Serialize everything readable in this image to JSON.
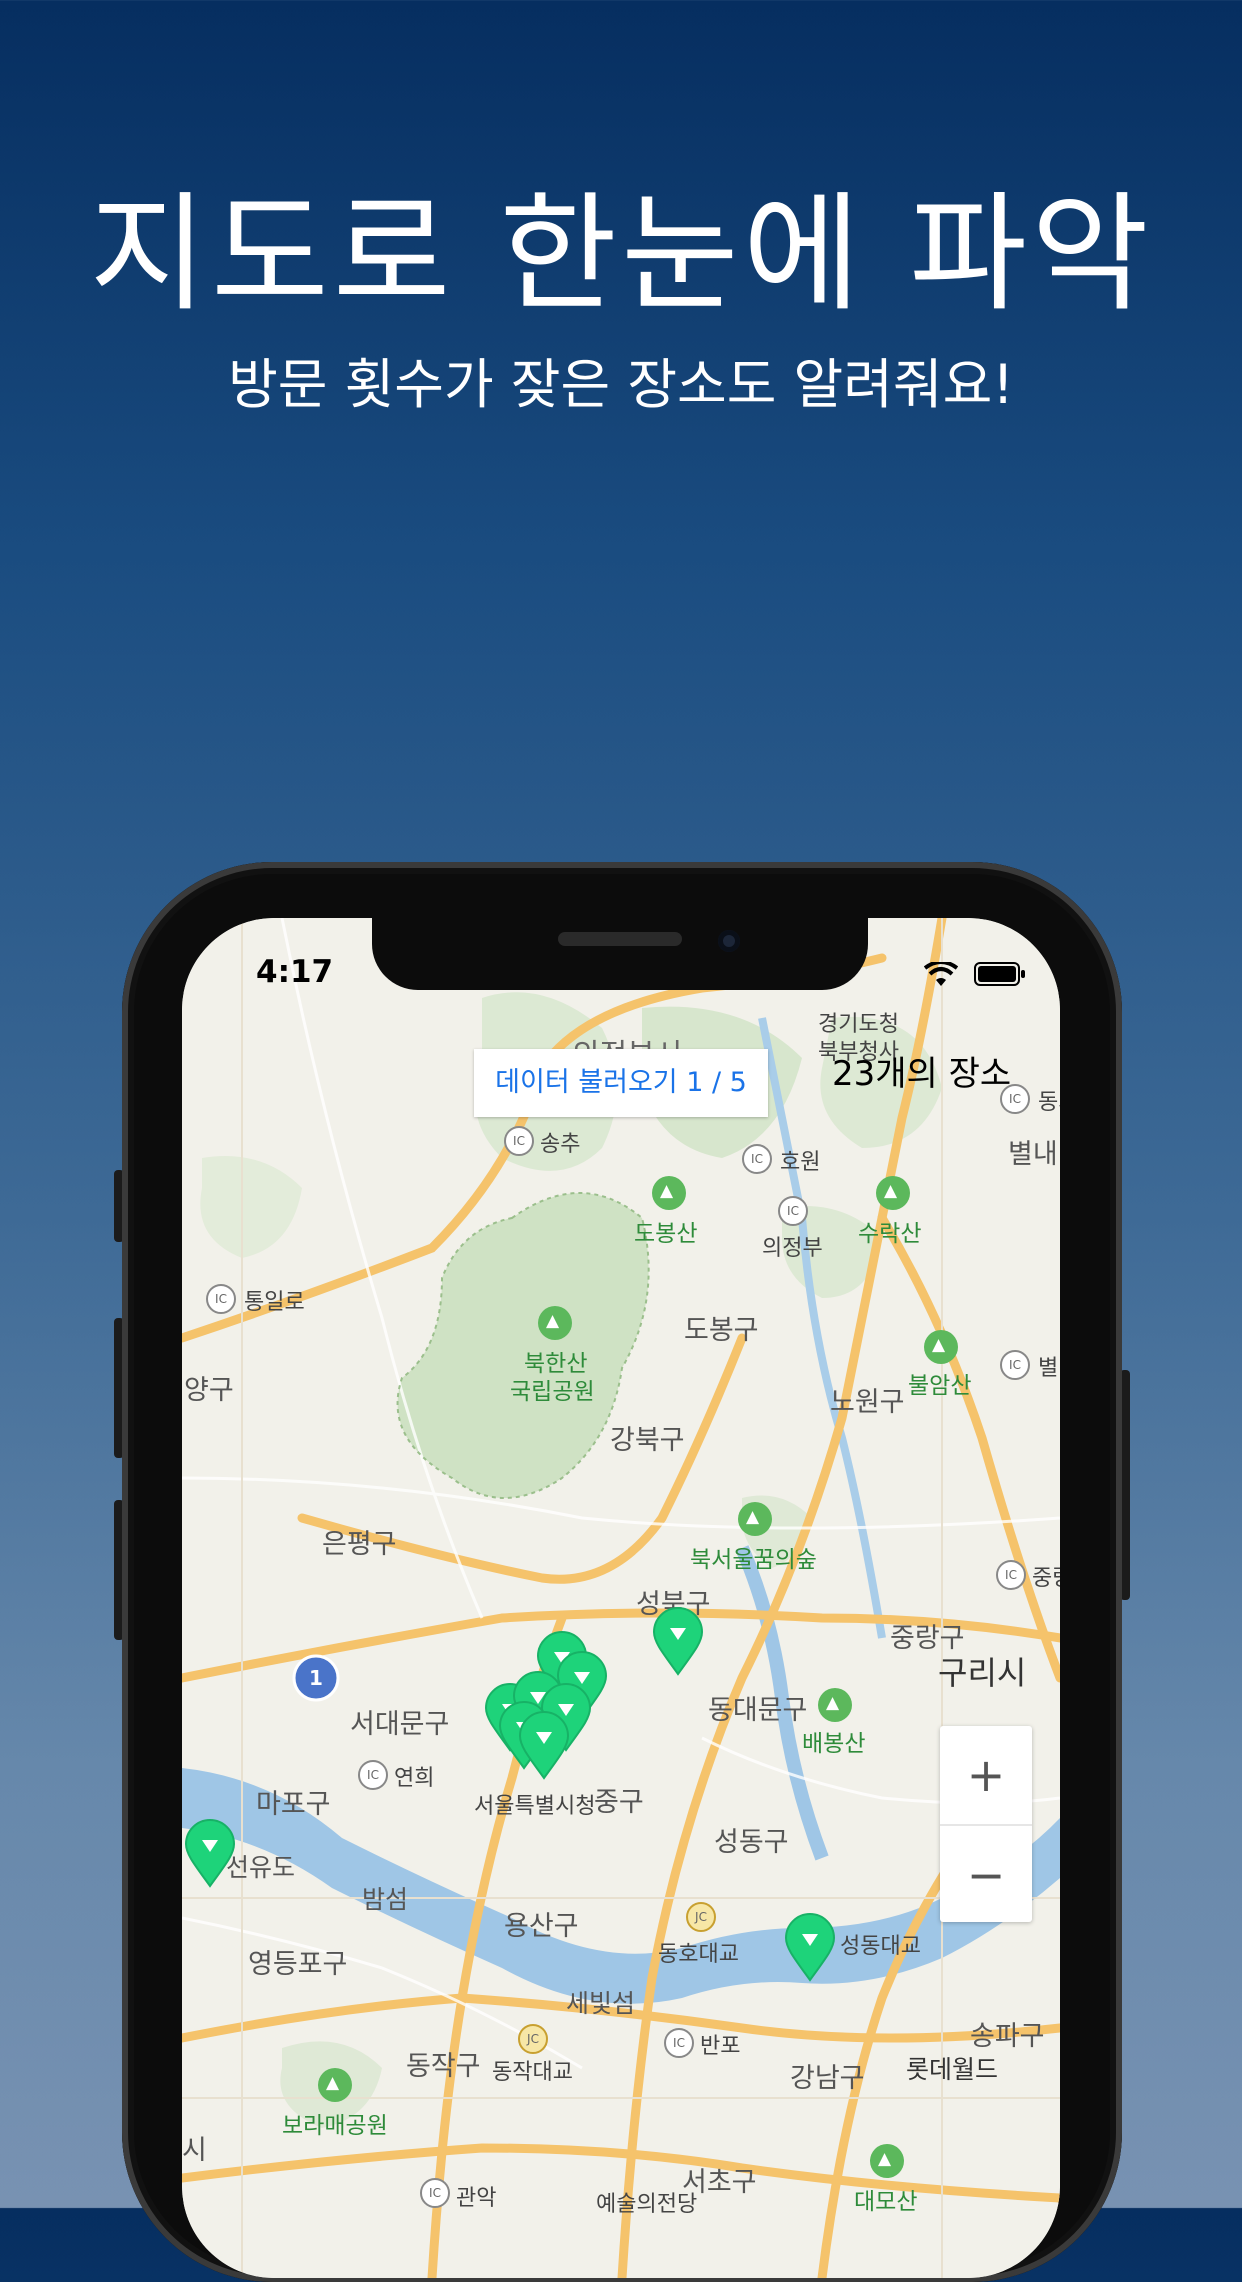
{
  "headline": "지도로 한눈에 파악",
  "subheadline": "방문 횟수가 잦은 장소도 알려줘요!",
  "status_bar": {
    "time": "4:17"
  },
  "map": {
    "load_button_label": "데이터 불러오기 1 / 5",
    "place_count_label": "23개의 장소",
    "zoom_in": "+",
    "zoom_out": "−",
    "labels": {
      "uijeongbu_top": "의정부시",
      "gyeonggi_office": "경기도청",
      "gyeonggi_office2": "북부청사",
      "songchu": "송추",
      "howon": "호원",
      "dobongsan": "도봉산",
      "suraksan": "수락산",
      "uijeongbu": "의정부",
      "tongilro": "통일로",
      "bukhansan": "북한산",
      "bukhansan2": "국립공원",
      "dobong_gu": "도봉구",
      "buramsan": "불암산",
      "nowon_gu": "노원구",
      "yang_gu": "양구",
      "gangbuk_gu": "강북구",
      "eunpyeong_gu": "은평구",
      "bukseoul_forest": "북서울꿈의숲",
      "seongbuk_gu": "성북구",
      "jungnang_gu": "중랑구",
      "guri_si": "구리시",
      "seodaemun_gu": "서대문구",
      "dongdaemun_gu": "동대문구",
      "baebongsan": "배봉산",
      "yeonhui": "연희",
      "mapo_gu": "마포구",
      "city_hall": "서울특별시청",
      "jung_gu": "중구",
      "seongdong_gu": "성동구",
      "seonyudo": "선유도",
      "bamseom": "밤섬",
      "yongsan_gu": "용산구",
      "donghodaegyo": "동호대교",
      "yeongdeungpo_gu": "영등포구",
      "sebitseom": "세빛섬",
      "banpo": "반포",
      "songpa_gu": "송파구",
      "lotteworld": "롯데월드",
      "dongjak_gu": "동작구",
      "dongjakdaegyo": "동작대교",
      "gangnam_gu": "강남구",
      "boramae": "보라매공원",
      "seocho_gu": "서초구",
      "gwanak": "관악",
      "art_center": "예술의전당",
      "daemosan": "대모산",
      "dong": "동의",
      "byeol": "별내",
      "byeol2": "별",
      "jungrang_ic": "중랑",
      "seongdongdaegyo": "성동대교",
      "route_1": "1",
      "si_left": "시",
      "ic_text": "IC",
      "jc_text": "JC"
    }
  },
  "colors": {
    "pin": "#1ed37a",
    "accent": "#1a73e8",
    "background_top": "#062e60",
    "background_bottom": "#7892b2"
  }
}
